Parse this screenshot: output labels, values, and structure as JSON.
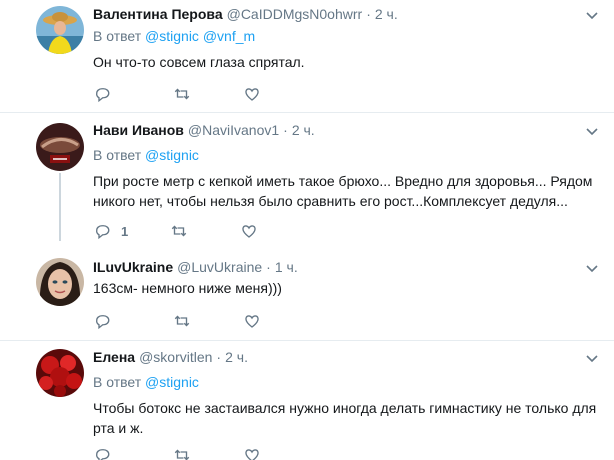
{
  "tweets": [
    {
      "name": "Валентина Перова",
      "handle": "@CaIDDMgsN0ohwrr",
      "sep": "·",
      "time": "2 ч.",
      "reply_label": "В ответ",
      "reply_mentions": "@stignic @vnf_m",
      "text": "Он что-то совсем глаза спрятал.",
      "reply_count": ""
    },
    {
      "name": "Нави Иванов",
      "handle": "@NaviIvanov1",
      "sep": "·",
      "time": "2 ч.",
      "reply_label": "В ответ",
      "reply_mentions": "@stignic",
      "text": "При росте метр с кепкой иметь такое брюхо... Вредно для здоровья... Рядом никого нет, чтобы нельзя было сравнить его рост...Комплексует дедуля...",
      "reply_count": "1"
    },
    {
      "name": "ILuvUkraine",
      "handle": "@LuvUkraine",
      "sep": "·",
      "time": "1 ч.",
      "text": "163см- немного ниже меня)))",
      "reply_count": ""
    },
    {
      "name": "Елена",
      "handle": "@skorvitlen",
      "sep": "·",
      "time": "2 ч.",
      "reply_label": "В ответ",
      "reply_mentions": "@stignic",
      "text": "Чтобы ботокс не застаивался нужно иногда делать гимнастику не только для рта и ж.",
      "reply_count": ""
    }
  ],
  "colors": {
    "link": "#1da1f2",
    "secondary": "#657786",
    "divider": "#e6ecf0",
    "thread_line": "#ccd6dd"
  },
  "icons": [
    "reply-icon",
    "retweet-icon",
    "like-icon",
    "caret-down-icon"
  ]
}
